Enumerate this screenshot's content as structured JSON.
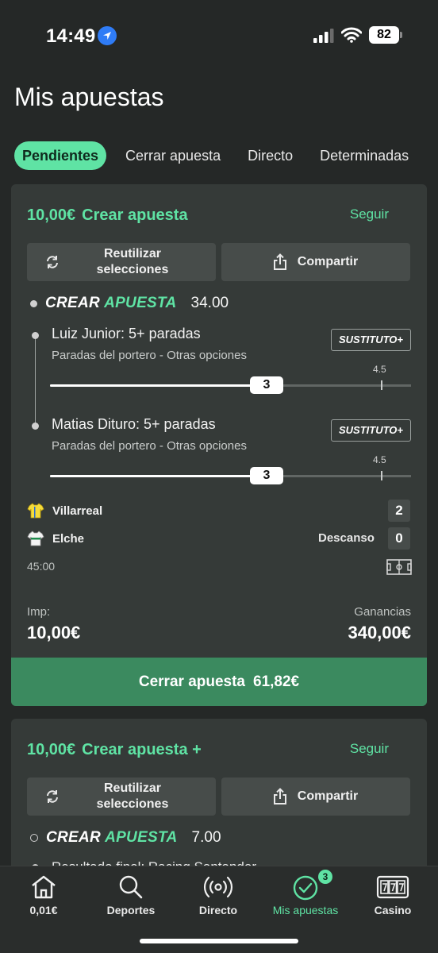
{
  "status_bar": {
    "time": "14:49",
    "battery": "82"
  },
  "page": {
    "title": "Mis apuestas"
  },
  "tabs": [
    {
      "label": "Pendientes",
      "active": true
    },
    {
      "label": "Cerrar apuesta"
    },
    {
      "label": "Directo"
    },
    {
      "label": "Determinadas"
    }
  ],
  "bet1": {
    "stake": "10,00€",
    "type": "Crear apuesta",
    "follow": "Seguir",
    "reuse_label": "Reutilizar selecciones",
    "share_label": "Compartir",
    "logo_white": "CREAR",
    "logo_green": "APUESTA",
    "odds": "34.00",
    "legs": [
      {
        "title": "Luiz Junior: 5+ paradas",
        "sub": "Paradas del portero - Otras opciones",
        "badge": "SUSTITUTO+",
        "current": "3",
        "line": "4.5",
        "progress": 0.6
      },
      {
        "title": "Matias Dituro: 5+ paradas",
        "sub": "Paradas del portero - Otras opciones",
        "badge": "SUSTITUTO+",
        "current": "3",
        "line": "4.5",
        "progress": 0.6
      }
    ],
    "match": {
      "home": "Villarreal",
      "home_score": "2",
      "away": "Elche",
      "away_score": "0",
      "period": "Descanso",
      "clock": "45:00"
    },
    "stake_label": "Imp:",
    "stake_value": "10,00€",
    "returns_label": "Ganancias",
    "returns_value": "340,00€",
    "cashout_label": "Cerrar apuesta",
    "cashout_amount": "61,82€"
  },
  "bet2": {
    "stake": "10,00€",
    "type": "Crear apuesta +",
    "follow": "Seguir",
    "reuse_label": "Reutilizar selecciones",
    "share_label": "Compartir",
    "logo_white": "CREAR",
    "logo_green": "APUESTA",
    "odds": "7.00",
    "first_leg_partial": "Resultado final: Racing Santander"
  },
  "nav": [
    {
      "label": "0,01€",
      "icon": "home-icon"
    },
    {
      "label": "Deportes",
      "icon": "search-icon"
    },
    {
      "label": "Directo",
      "icon": "live-icon"
    },
    {
      "label": "Mis apuestas",
      "icon": "check-circle-icon",
      "badge": "3",
      "active": true
    },
    {
      "label": "Casino",
      "icon": "slot-machine-icon"
    }
  ],
  "colors": {
    "accent": "#5fe3a4",
    "cashout": "#3b8a5f",
    "card": "#353a38",
    "background": "#252827"
  }
}
